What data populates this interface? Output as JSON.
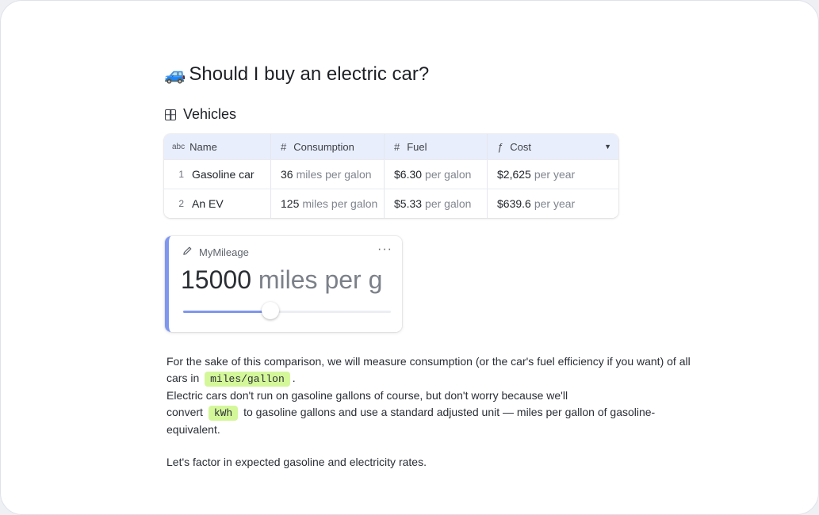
{
  "page": {
    "title_icon": "🚙",
    "title": "Should I buy an electric car?",
    "section_title": "Vehicles"
  },
  "table": {
    "headers": {
      "name_type": "abc",
      "name": "Name",
      "consumption_type": "#",
      "consumption": "Consumption",
      "fuel_type": "#",
      "fuel": "Fuel",
      "cost_type": "ƒ",
      "cost": "Cost"
    },
    "rows": [
      {
        "num": "1",
        "name": "Gasoline car",
        "consumption": "36",
        "consumption_unit": "miles per galon",
        "fuel": "$6.30",
        "fuel_unit": "per galon",
        "cost": "$2,625",
        "cost_unit": "per year"
      },
      {
        "num": "2",
        "name": "An EV",
        "consumption": "125",
        "consumption_unit": "miles per galon",
        "fuel": "$5.33",
        "fuel_unit": "per galon",
        "cost": "$639.6",
        "cost_unit": "per year"
      }
    ]
  },
  "mileage": {
    "label": "MyMileage",
    "value": "15000",
    "unit": "miles per g",
    "more": "···",
    "slider_fraction": 0.42
  },
  "text": {
    "line1": "For the sake of this comparison, we will measure consumption (or the car's fuel efficiency if you want) of all cars in",
    "code1": "miles/gallon",
    "line1_end": ".",
    "line2": "Electric cars don't run on gasoline gallons of course, but don't worry because we'll",
    "line3_start": "convert",
    "code2": "kWh",
    "line3_end": "to gasoline gallons and use a standard adjusted unit — miles per gallon of gasoline-equivalent.",
    "line4": "Let's factor in expected gasoline and electricity rates."
  },
  "colors": {
    "accent": "#7f97f0",
    "code_highlight": "#d4f79a",
    "table_header": "#e9eefc"
  }
}
